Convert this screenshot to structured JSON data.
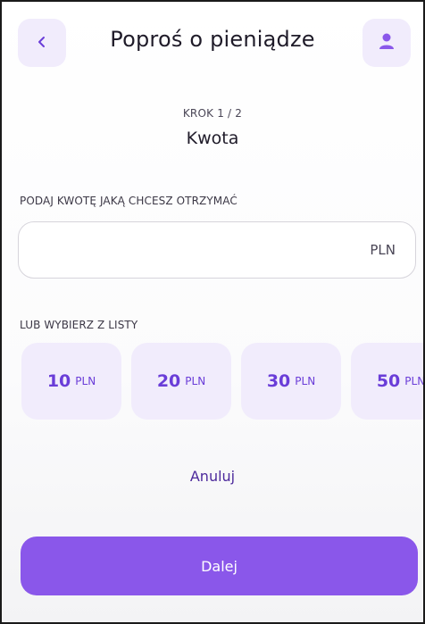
{
  "header": {
    "title": "Poproś o pieniądze",
    "back_icon": "chevron-left-icon",
    "profile_icon": "user-icon"
  },
  "step": {
    "indicator": "KROK 1 / 2",
    "title": "Kwota"
  },
  "amount": {
    "label": "PODAJ KWOTĘ JAKĄ CHCESZ OTRZYMAĆ",
    "value": "",
    "placeholder": "",
    "currency": "PLN"
  },
  "quick_amounts": {
    "label": "LUB WYBIERZ Z LISTY",
    "items": [
      {
        "value": "10",
        "currency": "PLN"
      },
      {
        "value": "20",
        "currency": "PLN"
      },
      {
        "value": "30",
        "currency": "PLN"
      },
      {
        "value": "50",
        "currency": "PLN"
      }
    ]
  },
  "actions": {
    "cancel_label": "Anuluj",
    "next_label": "Dalej"
  },
  "colors": {
    "accent": "#8a57ea",
    "accent_text": "#6a3dd8",
    "chip_bg": "#f1ecfc"
  }
}
